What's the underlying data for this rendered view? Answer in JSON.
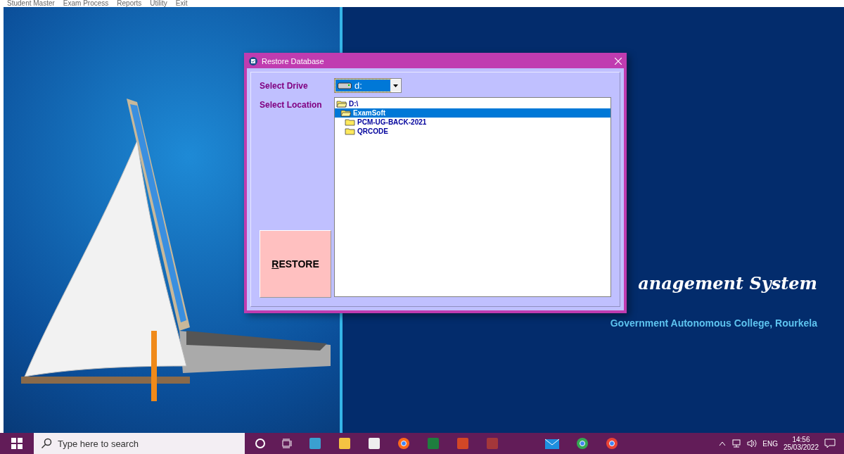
{
  "menu": [
    "Student Master",
    "Exam Process",
    "Reports",
    "Utility",
    "Exit"
  ],
  "background": {
    "title": "anagement System",
    "subtitle": "Government Autonomous College, Rourkela"
  },
  "dialog": {
    "title": "Restore Database",
    "drive_label": "Select Drive",
    "drive_value": "d:",
    "location_label": "Select Location",
    "button": "RESTORE",
    "tree": [
      {
        "label": "D:\\",
        "selected": false,
        "children": [
          {
            "label": "ExamSoft",
            "selected": true,
            "children": [
              {
                "label": "PCM-UG-BACK-2021",
                "selected": false
              },
              {
                "label": "QRCODE",
                "selected": false
              }
            ]
          }
        ]
      }
    ]
  },
  "taskbar": {
    "search_placeholder": "Type here to search",
    "language": "ENG",
    "time": "14:56",
    "date": "25/03/2022"
  }
}
